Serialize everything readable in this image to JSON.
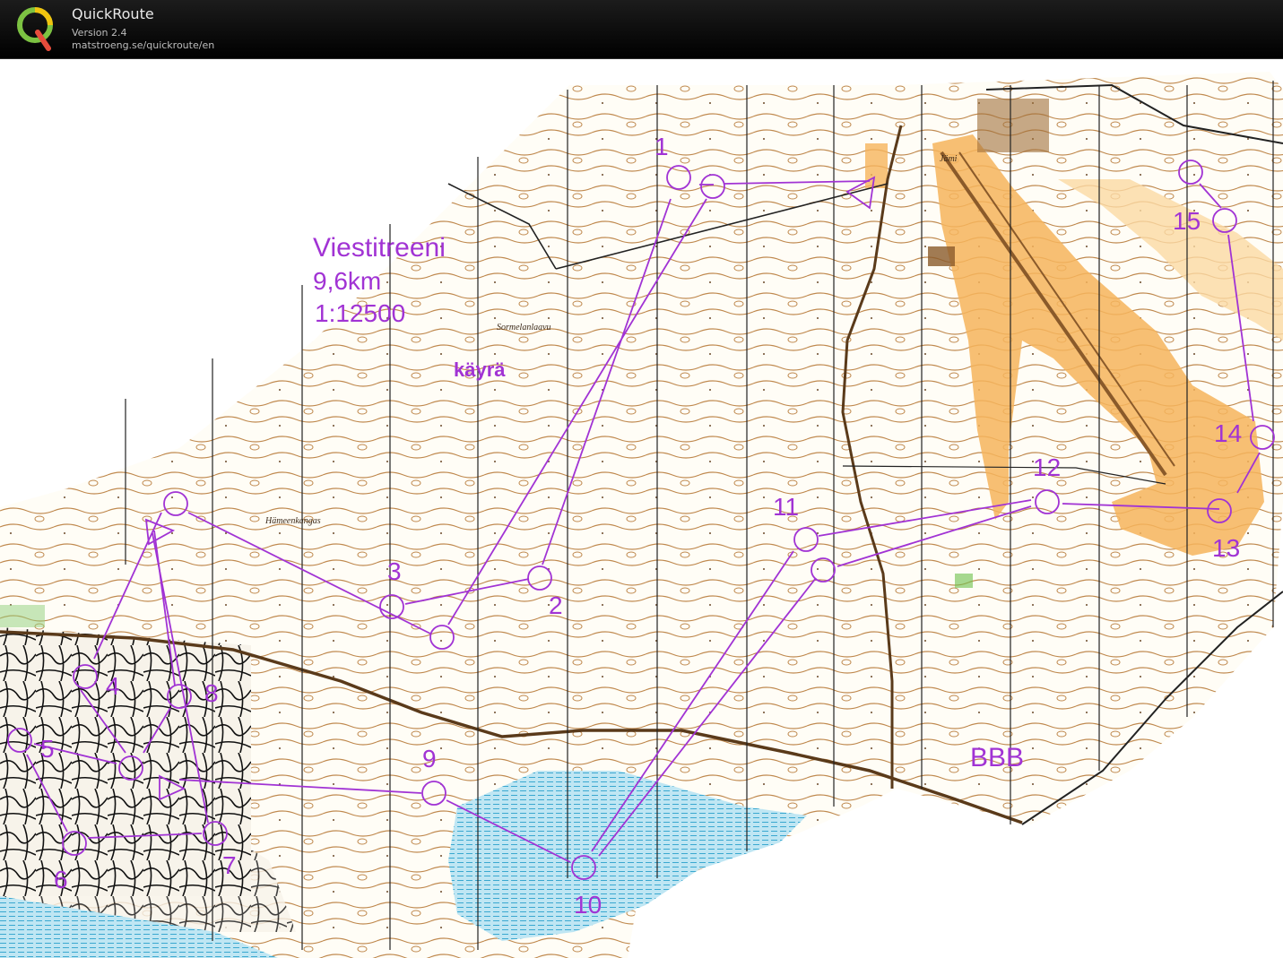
{
  "app": {
    "name": "QuickRoute",
    "version": "Version 2.4",
    "url": "matstroeng.se/quickroute/en"
  },
  "course": {
    "title": "Viestitreeni",
    "distance": "9,6km",
    "scale": "1:12500",
    "note": "käyrä",
    "marker": "BBB"
  },
  "place_names": {
    "sormelanlaavu": "Sormelanlaavu",
    "hameenkangas": "Hämeenkangas",
    "jami": "Jämi"
  },
  "controls": [
    {
      "label": "1"
    },
    {
      "label": "2"
    },
    {
      "label": "3"
    },
    {
      "label": "4"
    },
    {
      "label": "5"
    },
    {
      "label": "6"
    },
    {
      "label": "7"
    },
    {
      "label": "8"
    },
    {
      "label": "9"
    },
    {
      "label": "10"
    },
    {
      "label": "11"
    },
    {
      "label": "12"
    },
    {
      "label": "13"
    },
    {
      "label": "14"
    },
    {
      "label": "15"
    }
  ],
  "colors": {
    "overprint": "#a133d4",
    "contour": "#a0703a",
    "open_land": "#f6b45c",
    "water": "#4fb5d8",
    "track": "#000000"
  }
}
